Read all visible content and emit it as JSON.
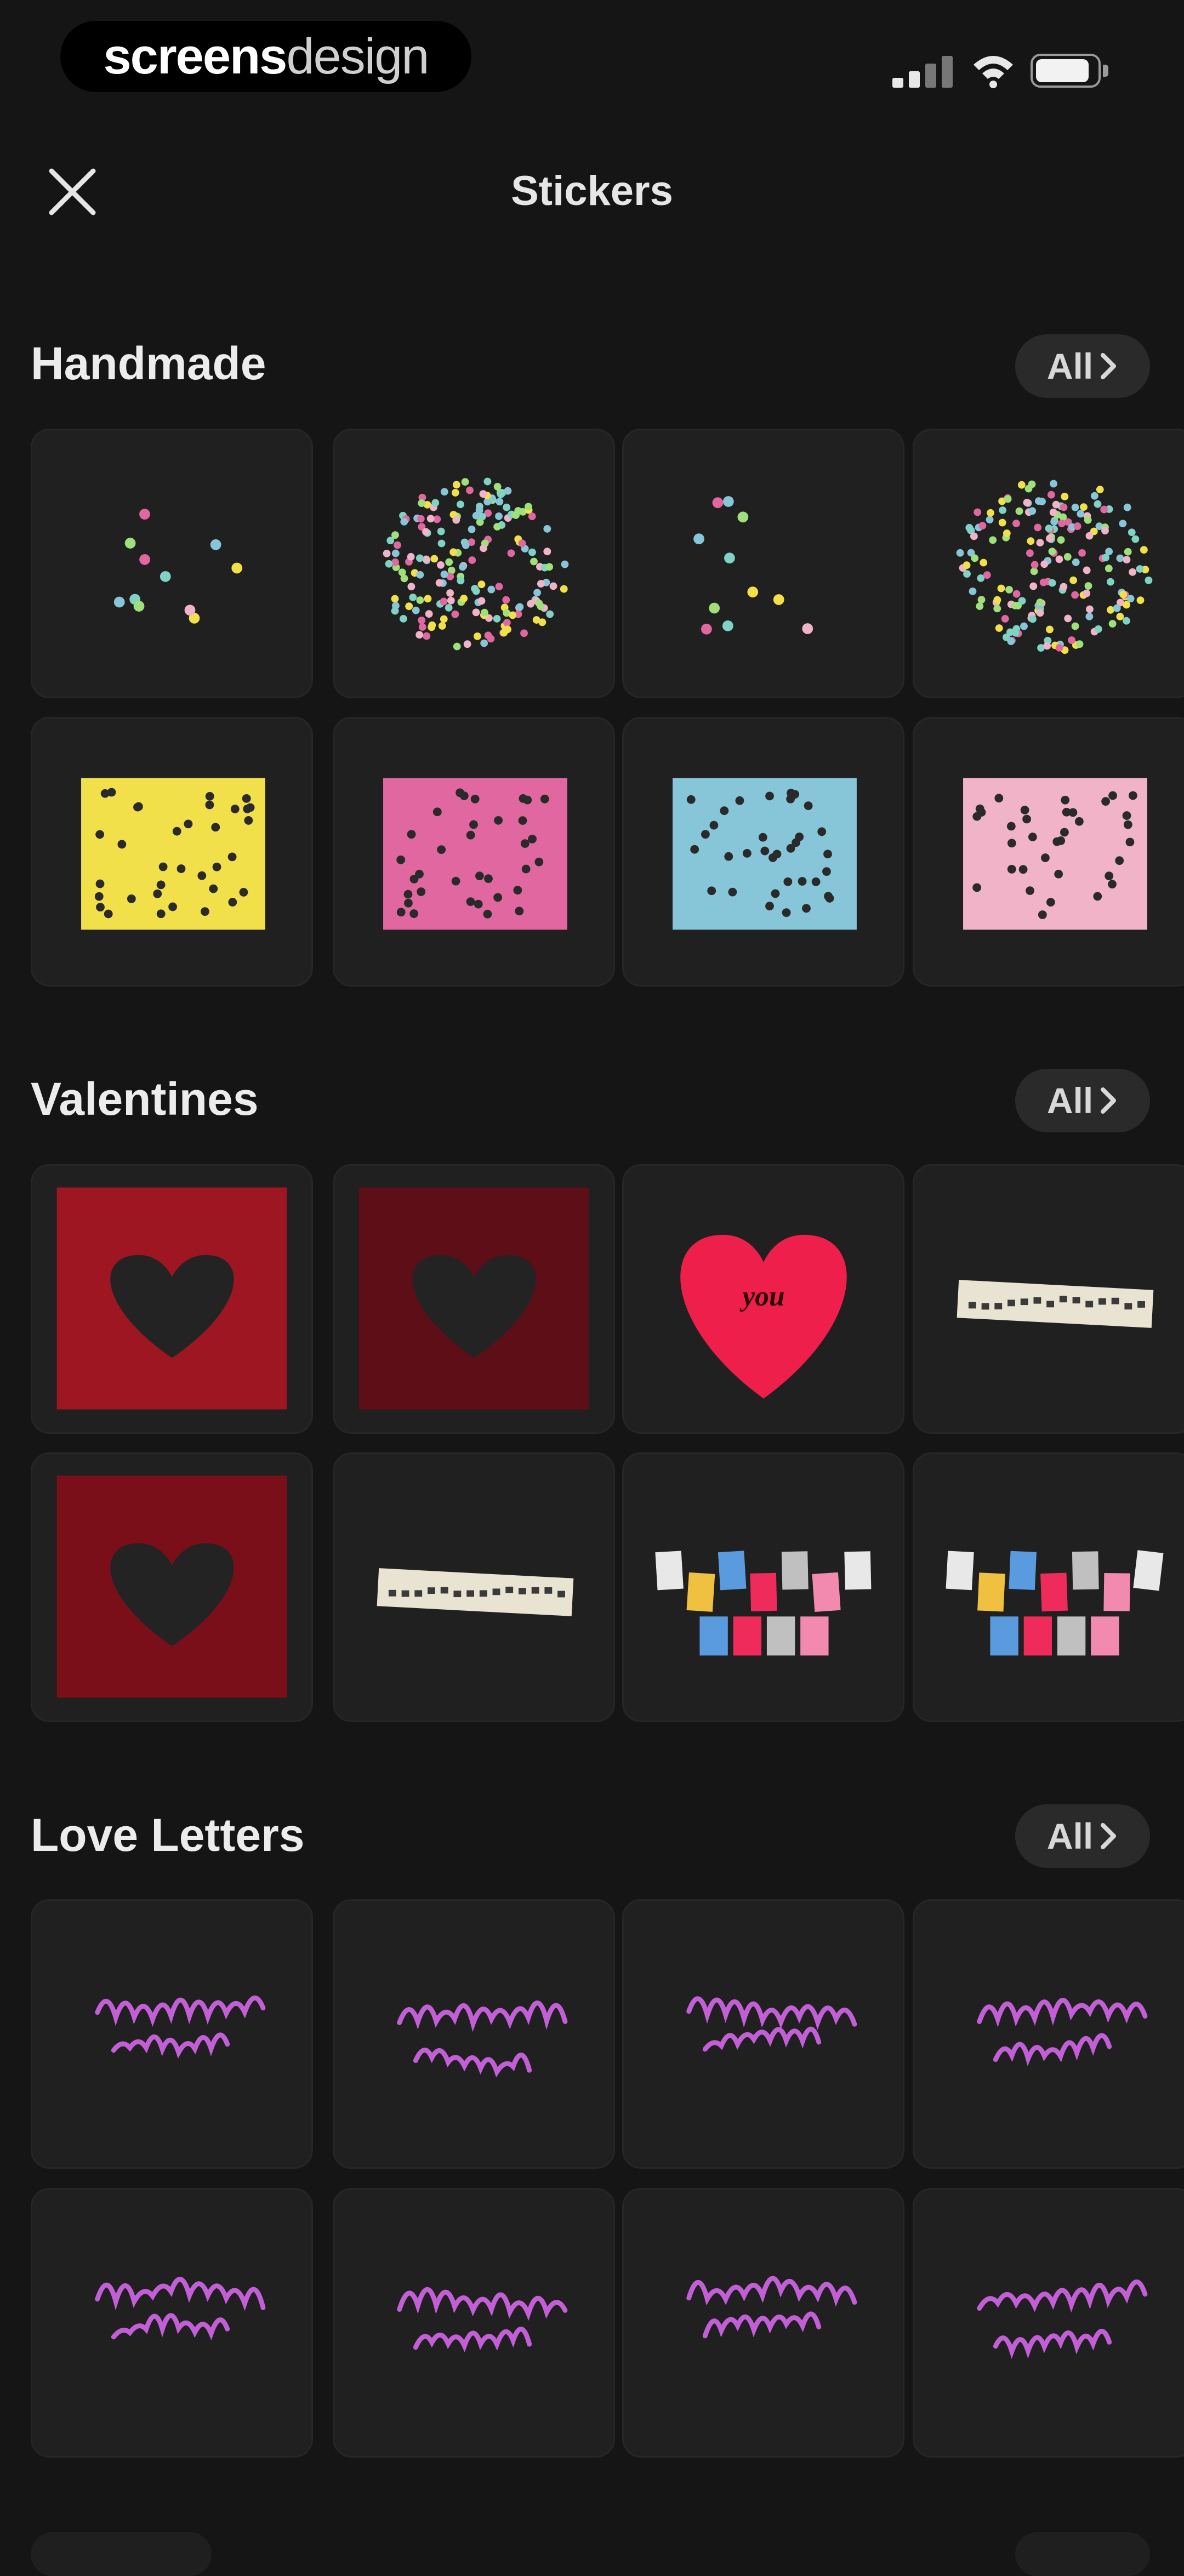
{
  "status_bar": {
    "brand_bold": "screens",
    "brand_light": "design",
    "icons": [
      "signal-icon",
      "wifi-icon",
      "battery-icon"
    ]
  },
  "nav": {
    "title": "Stickers",
    "close_icon": "close-icon"
  },
  "sections": [
    {
      "title": "Handmade",
      "all_label": "All",
      "stickers": [
        {
          "kind": "confetti-sparse"
        },
        {
          "kind": "confetti-dense"
        },
        {
          "kind": "confetti-sparse"
        },
        {
          "kind": "confetti-dense"
        },
        {
          "kind": "dotted-card",
          "color": "#f2e04b"
        },
        {
          "kind": "dotted-card",
          "color": "#e0679f"
        },
        {
          "kind": "dotted-card",
          "color": "#86c6d8"
        },
        {
          "kind": "dotted-card",
          "color": "#f0b3c8"
        }
      ]
    },
    {
      "title": "Valentines",
      "all_label": "All",
      "stickers": [
        {
          "kind": "heart-card",
          "color": "#9e1622"
        },
        {
          "kind": "heart-card",
          "color": "#5e0e16"
        },
        {
          "kind": "red-heart",
          "text": "you",
          "color": "#ee1f4b"
        },
        {
          "kind": "torn-text"
        },
        {
          "kind": "heart-card",
          "color": "#7a0f1a"
        },
        {
          "kind": "torn-text"
        },
        {
          "kind": "ransom-text"
        },
        {
          "kind": "ransom-text"
        }
      ]
    },
    {
      "title": "Love Letters",
      "all_label": "All",
      "stickers": [
        {
          "kind": "script"
        },
        {
          "kind": "script"
        },
        {
          "kind": "script"
        },
        {
          "kind": "script"
        },
        {
          "kind": "script"
        },
        {
          "kind": "script"
        },
        {
          "kind": "script"
        },
        {
          "kind": "script"
        }
      ]
    }
  ],
  "colors": {
    "background": "#151515",
    "tile": "#202020",
    "script_purple": "#c35fd6"
  }
}
